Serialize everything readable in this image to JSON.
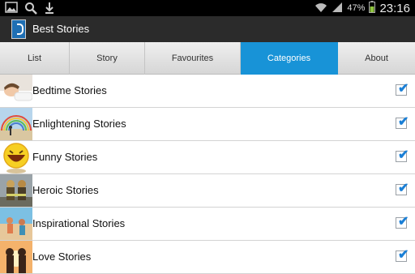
{
  "status_bar": {
    "battery": "47%",
    "time": "23:16",
    "icons": [
      "gallery-icon",
      "search-icon",
      "download-icon",
      "wifi-icon",
      "signal-icon",
      "battery-icon"
    ]
  },
  "app": {
    "title": "Best Stories",
    "icon": "best-stories-app-icon"
  },
  "tabs": [
    {
      "label": "List",
      "active": false
    },
    {
      "label": "Story",
      "active": false
    },
    {
      "label": "Favourites",
      "active": false
    },
    {
      "label": "Categories",
      "active": true
    },
    {
      "label": "About",
      "active": false
    }
  ],
  "categories": [
    {
      "label": "Bedtime Stories",
      "checked": true,
      "thumbnail": "sleeping-baby-image"
    },
    {
      "label": "Enlightening Stories",
      "checked": true,
      "thumbnail": "rainbow-beach-image"
    },
    {
      "label": "Funny Stories",
      "checked": true,
      "thumbnail": "laughing-face-image"
    },
    {
      "label": "Heroic Stories",
      "checked": true,
      "thumbnail": "firefighters-image"
    },
    {
      "label": "Inspirational Stories",
      "checked": true,
      "thumbnail": "beach-people-image"
    },
    {
      "label": "Love Stories",
      "checked": true,
      "thumbnail": "couple-sunset-image"
    }
  ],
  "colors": {
    "active_tab": "#1893d7",
    "checkmark": "#1a7fd6",
    "app_bar": "#2b2b2b"
  }
}
